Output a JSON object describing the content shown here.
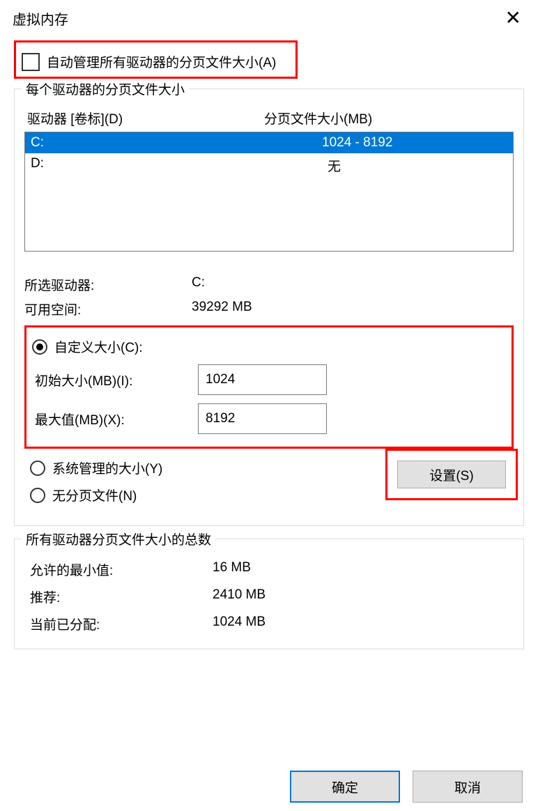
{
  "title": "虚拟内存",
  "checkbox": {
    "label": "自动管理所有驱动器的分页文件大小(A)",
    "checked": false
  },
  "group_per_drive": {
    "legend": "每个驱动器的分页文件大小",
    "header_drive": "驱动器 [卷标](D)",
    "header_size": "分页文件大小(MB)",
    "rows": [
      {
        "drive": "C:",
        "size": "1024 - 8192",
        "selected": true
      },
      {
        "drive": "D:",
        "size": "无",
        "selected": false
      }
    ],
    "selected_drive_label": "所选驱动器:",
    "selected_drive_value": "C:",
    "free_space_label": "可用空间:",
    "free_space_value": "39292 MB",
    "radio_custom": "自定义大小(C):",
    "initial_label": "初始大小(MB)(I):",
    "initial_value": "1024",
    "max_label": "最大值(MB)(X):",
    "max_value": "8192",
    "radio_system": "系统管理的大小(Y)",
    "radio_none": "无分页文件(N)",
    "set_button": "设置(S)"
  },
  "group_totals": {
    "legend": "所有驱动器分页文件大小的总数",
    "min_label": "允许的最小值:",
    "min_value": "16 MB",
    "rec_label": "推荐:",
    "rec_value": "2410 MB",
    "cur_label": "当前已分配:",
    "cur_value": "1024 MB"
  },
  "buttons": {
    "ok": "确定",
    "cancel": "取消"
  }
}
